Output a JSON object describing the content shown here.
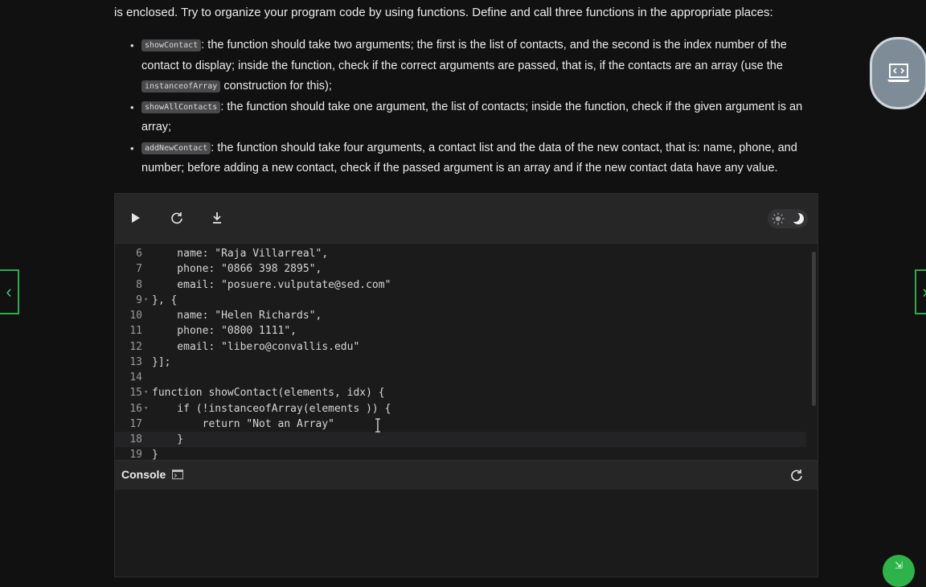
{
  "intro": {
    "text": "is enclosed. Try to organize your program code by using functions. Define and call three functions in the appropriate places:"
  },
  "bullets": [
    {
      "chip": "showContact",
      "text_a": ": the function should take two arguments; the first is the list of contacts, and the second is the index number of the contact to display; inside the function, check if the correct arguments are passed, that is, if the contacts are an array (use the ",
      "chip2": "instanceofArray",
      "text_b": " construction for this);"
    },
    {
      "chip": "showAllContacts",
      "text_a": ": the function should take one argument, the list of contacts; inside the function, check if the given argument is an array;"
    },
    {
      "chip": "addNewContact",
      "text_a": ": the function should take four arguments, a contact list and the data of the new contact, that is: name, phone, and number; before adding a new contact, check if the passed argument is an array and if the new contact data have any value."
    }
  ],
  "toolbar": {
    "run_icon": "play-icon",
    "reset_icon": "refresh-icon",
    "download_icon": "download-icon",
    "theme_icons": [
      "sun-icon",
      "moon-icon"
    ]
  },
  "code_lines": [
    {
      "n": "6",
      "fold": "",
      "t": "    name: \"Raja Villarreal\","
    },
    {
      "n": "7",
      "fold": "",
      "t": "    phone: \"0866 398 2895\","
    },
    {
      "n": "8",
      "fold": "",
      "t": "    email: \"posuere.vulputate@sed.com\""
    },
    {
      "n": "9",
      "fold": "▾",
      "t": "}, {"
    },
    {
      "n": "10",
      "fold": "",
      "t": "    name: \"Helen Richards\","
    },
    {
      "n": "11",
      "fold": "",
      "t": "    phone: \"0800 1111\","
    },
    {
      "n": "12",
      "fold": "",
      "t": "    email: \"libero@convallis.edu\""
    },
    {
      "n": "13",
      "fold": "",
      "t": "}];"
    },
    {
      "n": "14",
      "fold": "",
      "t": ""
    },
    {
      "n": "15",
      "fold": "▾",
      "t": "function showContact(elements, idx) {"
    },
    {
      "n": "16",
      "fold": "▾",
      "t": "    if (!instanceofArray(elements )) {"
    },
    {
      "n": "17",
      "fold": "",
      "t": "        return \"Not an Array\""
    },
    {
      "n": "18",
      "fold": "",
      "t": "    }"
    },
    {
      "n": "19",
      "fold": "",
      "t": "}"
    }
  ],
  "console": {
    "label": "Console"
  },
  "colors": {
    "accent_green": "#2db34a",
    "editor_bg": "#1b1b1c",
    "toolbar_bg": "#262627"
  }
}
